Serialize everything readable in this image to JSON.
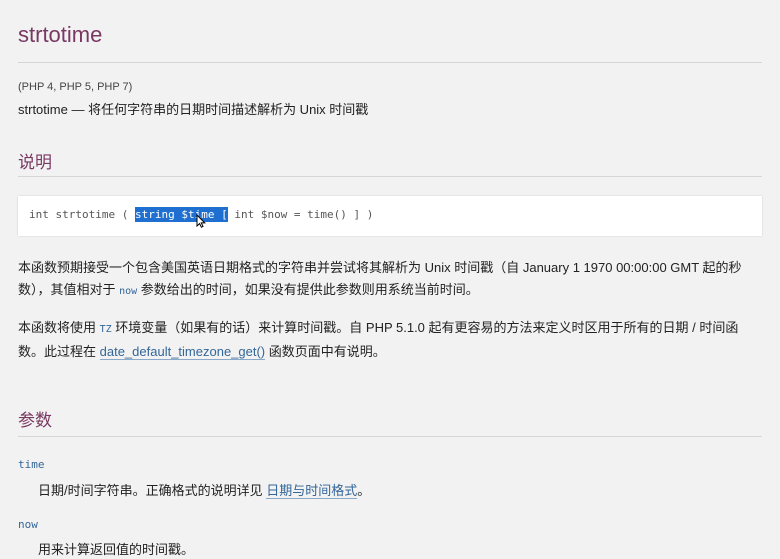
{
  "page": {
    "title": "strtotime",
    "versions": "(PHP 4, PHP 5, PHP 7)",
    "purpose": "strtotime — 将任何字符串的日期时间描述解析为 Unix 时间戳"
  },
  "description": {
    "heading": "说明",
    "signature": {
      "return_type": "int",
      "function_name": "strtotime",
      "open": "(",
      "selected_text": "string $time [",
      "rest": "int $now = time() ] )"
    },
    "para1_a": "本函数预期接受一个包含美国英语日期格式的字符串并尝试将其解析为 Unix 时间戳（自 January 1 1970 00:00:00 GMT 起的秒",
    "para1_b": "数），其值相对于 ",
    "para1_code": "now",
    "para1_c": " 参数给出的时间，如果没有提供此参数则用系统当前时间。",
    "para2_a": "本函数将使用 ",
    "para2_code": "TZ",
    "para2_b": " 环境变量（如果有的话）来计算时间戳。自 PHP 5.1.0 起有更容易的方法来定义时区用于所有的日期 / 时间函",
    "para2_c": "数。此过程在 ",
    "para2_link": "date_default_timezone_get()",
    "para2_d": " 函数页面中有说明。"
  },
  "parameters": {
    "heading": "参数",
    "items": [
      {
        "name": "time",
        "desc_a": "日期/时间字符串。正确格式的说明详见 ",
        "desc_link": "日期与时间格式",
        "desc_b": "。"
      },
      {
        "name": "now",
        "desc_a": "用来计算返回值的时间戳。",
        "desc_link": "",
        "desc_b": ""
      }
    ]
  },
  "colors": {
    "heading": "#793862",
    "link": "#336699",
    "selection": "#1e6fd0",
    "background": "#f2f2f2"
  },
  "icons": {
    "cursor": "mouse-pointer-icon"
  }
}
